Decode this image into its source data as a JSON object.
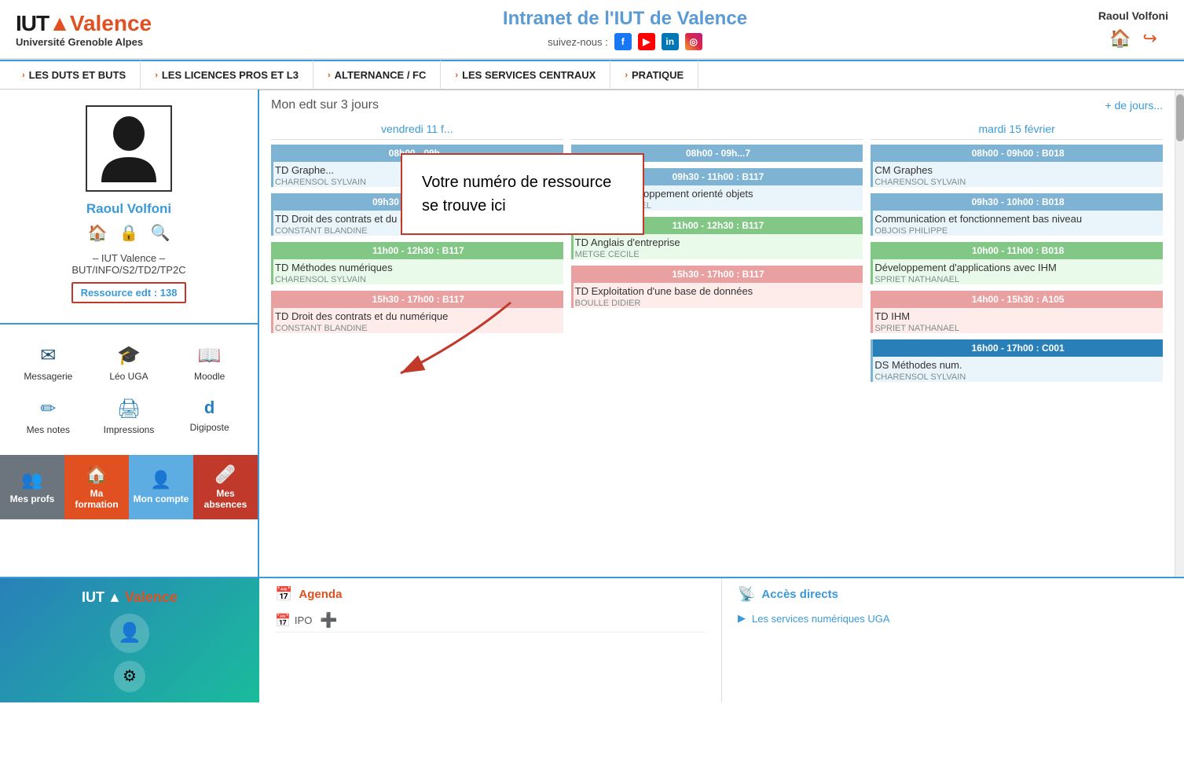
{
  "header": {
    "logo_iut": "IUT",
    "logo_triangle": "▲",
    "logo_valence": "Valence",
    "logo_subtitle": "Université Grenoble Alpes",
    "title": "Intranet de l'IUT de Valence",
    "suivez_label": "suivez-nous :",
    "username": "Raoul Volfoni",
    "social": [
      "f",
      "▶",
      "in",
      "◎"
    ]
  },
  "nav": {
    "items": [
      "LES DUTS et BUTS",
      "LES LICENCES PROS ET L3",
      "ALTERNANCE / FC",
      "LES SERVICES CENTRAUX",
      "PRATIQUE"
    ]
  },
  "sidebar": {
    "profile_name": "Raoul Volfoni",
    "info_line1": "– IUT Valence –",
    "info_line2": "BUT/INFO/S2/TD2/TP2C",
    "resource_label": "Ressource edt :",
    "resource_number": "138",
    "shortcuts": [
      {
        "label": "Messagerie",
        "icon": "✉"
      },
      {
        "label": "Léo UGA",
        "icon": "🎓"
      },
      {
        "label": "Moodle",
        "icon": "📖"
      },
      {
        "label": "Mes notes",
        "icon": "✏"
      },
      {
        "label": "Impressions",
        "icon": "🖨"
      },
      {
        "label": "Digiposte",
        "icon": "d"
      }
    ],
    "bottom_nav": [
      {
        "label": "Mes profs",
        "icon": "👥",
        "class": "profs"
      },
      {
        "label": "Ma formation",
        "icon": "🏠",
        "class": "formation"
      },
      {
        "label": "Mon compte",
        "icon": "👤",
        "class": "compte"
      },
      {
        "label": "Mes absences",
        "icon": "🩹",
        "class": "absences"
      }
    ]
  },
  "edt": {
    "title": "Mon edt sur 3 jours",
    "more": "+ de jours...",
    "days": [
      {
        "header": "vendredi 11 f...",
        "slots": [
          {
            "time": "08h00 - 09h...",
            "color": "blue",
            "title": "TD Graphe...",
            "teacher": "CHARENSOL SYLVAIN",
            "bg": "blue-bg"
          },
          {
            "time": "09h30 - 11h00 : B117",
            "color": "blue",
            "title": "TD Droit des contrats et du numérique",
            "teacher": "CONSTANT BLANDINE",
            "bg": "blue-bg"
          },
          {
            "time": "11h00 - 12h30 : B117",
            "color": "green",
            "title": "TD Méthodes numériques",
            "teacher": "CHARENSOL SYLVAIN",
            "bg": "green-bg"
          },
          {
            "time": "15h30 - 17h00 : B117",
            "color": "red",
            "title": "TD Droit des contrats et du numérique",
            "teacher": "CONSTANT BLANDINE",
            "bg": "red-bg"
          }
        ]
      },
      {
        "header": "",
        "slots": [
          {
            "time": "08h00 - 09h...7",
            "color": "blue",
            "title": "",
            "teacher": "",
            "bg": "blue-bg"
          },
          {
            "time": "09h30 - 11h00 : B117",
            "color": "blue",
            "title": "TD COO Développement orienté objets",
            "teacher": "OCCELLO MICHEL",
            "bg": "blue-bg"
          },
          {
            "time": "11h00 - 12h30 : B117",
            "color": "green",
            "title": "TD Anglais d'entreprise",
            "teacher": "METGE CECILE",
            "bg": "green-bg"
          },
          {
            "time": "15h30 - 17h00 : B117",
            "color": "red",
            "title": "TD Exploitation d'une base de données",
            "teacher": "BOULLE DIDIER",
            "bg": "red-bg"
          }
        ]
      },
      {
        "header": "mardi 15 février",
        "slots": [
          {
            "time": "08h00 - 09h00 : B018",
            "color": "blue",
            "title": "CM Graphes",
            "teacher": "CHARENSOL SYLVAIN",
            "bg": "blue-bg"
          },
          {
            "time": "09h30 - 10h00 : B018",
            "color": "blue",
            "title": "Communication et fonctionnement bas niveau",
            "teacher": "OBJOIS PHILIPPE",
            "bg": "blue-bg"
          },
          {
            "time": "10h00 - 11h00 : B018",
            "color": "green",
            "title": "Développement d'applications avec IHM",
            "teacher": "SPRIET NATHANAEL",
            "bg": "green-bg"
          },
          {
            "time": "14h00 - 15h30 : A105",
            "color": "red",
            "title": "TD IHM",
            "teacher": "SPRIET NATHANAEL",
            "bg": "red-bg"
          },
          {
            "time": "16h00 - 17h00 : C001",
            "color": "dark-blue",
            "title": "DS Méthodes num.",
            "teacher": "CHARENSOL SYLVAIN",
            "bg": "blue-bg"
          }
        ]
      }
    ]
  },
  "annotation": {
    "text": "Votre numéro de ressource se trouve ici"
  },
  "bottom": {
    "agenda_title": "Agenda",
    "agenda_items": [
      {
        "icon": "📅",
        "text": "IPO"
      },
      {
        "icon": "➕",
        "text": ""
      }
    ],
    "acces_title": "Accès directs",
    "acces_items": [
      {
        "icon": "▶",
        "text": "Les services numériques UGA"
      }
    ]
  }
}
